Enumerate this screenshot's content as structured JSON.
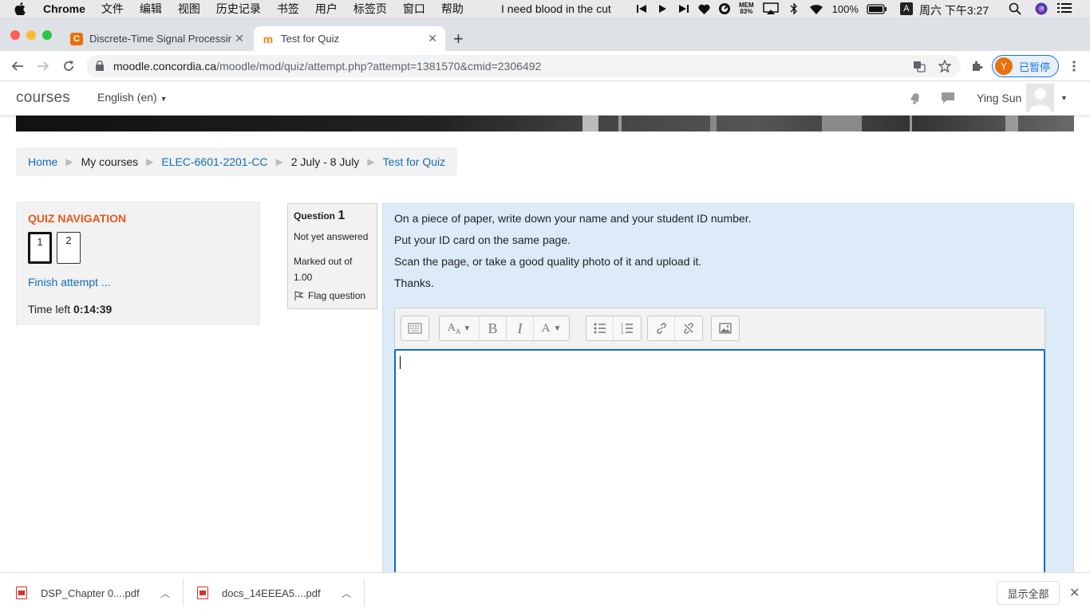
{
  "menubar": {
    "app_name": "Chrome",
    "menus": [
      "文件",
      "编辑",
      "视图",
      "历史记录",
      "书签",
      "用户",
      "标签页",
      "窗口",
      "帮助"
    ],
    "now_playing": "I need blood in the cut",
    "mem_label": "MEM",
    "mem_value": "83%",
    "battery": "100%",
    "input_method": "A",
    "clock": "周六 下午3:27"
  },
  "tabs": [
    {
      "title": "Discrete-Time Signal Processin",
      "favicon": "C",
      "favicon_color": "#e8710a"
    },
    {
      "title": "Test for Quiz",
      "favicon": "m",
      "favicon_color": "#f98012"
    }
  ],
  "address": {
    "domain": "moodle.concordia.ca",
    "path": "/moodle/mod/quiz/attempt.php?attempt=1381570&cmid=2306492"
  },
  "profile": {
    "initial": "Y",
    "label": "已暂停"
  },
  "moodle": {
    "site_name": "courses",
    "language": "English (en)",
    "user_name": "Ying Sun"
  },
  "breadcrumb": [
    "Home",
    "My courses",
    "ELEC-6601-2201-CC",
    "2 July - 8 July",
    "Test for Quiz"
  ],
  "quiz_nav": {
    "title": "QUIZ NAVIGATION",
    "buttons": [
      "1",
      "2"
    ],
    "finish": "Finish attempt ...",
    "time_label": "Time left",
    "time_value": "0:14:39"
  },
  "question": {
    "label": "Question",
    "number": "1",
    "state": "Not yet answered",
    "grade": "Marked out of 1.00",
    "flag": "Flag question",
    "text": [
      "On a piece of paper, write down your name and your student ID number.",
      "Put your ID card on the same page.",
      "Scan the page, or take a good quality photo of it and upload it.",
      "Thanks."
    ]
  },
  "downloads": {
    "files": [
      "DSP_Chapter 0....pdf",
      "docs_14EEEA5....pdf"
    ],
    "show_all": "显示全部"
  },
  "colors": {
    "link": "#0f6cbf",
    "quiz_nav_title": "#e8571c",
    "question_bg": "#dcebf7"
  }
}
